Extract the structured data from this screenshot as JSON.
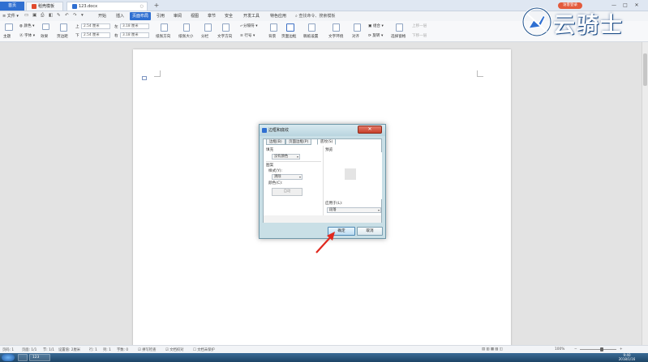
{
  "tabs": {
    "home": "首页",
    "template": "稻壳模板",
    "document": "123.docx",
    "add": "+"
  },
  "header_right": {
    "login": "访客登录",
    "window_controls": [
      "—",
      "□",
      "✕"
    ]
  },
  "menubar": {
    "file": "文件",
    "items": [
      "开始",
      "插入",
      "页面布局",
      "引用",
      "审阅",
      "视图",
      "章节",
      "安全",
      "开发工具",
      "特色应用"
    ],
    "active": "页面布局",
    "command_search": "查找命令、搜索模板"
  },
  "ribbon": {
    "theme": "主题",
    "colors": "颜色",
    "fonts": "字体",
    "effects": "效果",
    "margins": "页边距",
    "top_label": "上",
    "top_value": "2.54 厘米",
    "bottom_label": "下",
    "bottom_value": "2.54 厘米",
    "left_label": "左",
    "left_value": "3.18 厘米",
    "right_label": "右",
    "right_value": "3.18 厘米",
    "orientation": "纸张方向",
    "size": "纸张大小",
    "columns": "分栏",
    "text_direction": "文字方向",
    "line_numbers": "行号",
    "breaks": "分隔符",
    "background": "背景",
    "page_border": "页面边框",
    "draft_watermark": "稿纸设置",
    "text_wrap": "文字环绕",
    "align": "对齐",
    "rotate": "旋转",
    "group": "组合",
    "selection_pane": "选择窗格",
    "bring_forward": "上移一层",
    "send_backward": "下移一层"
  },
  "dialog": {
    "title": "边框和底纹",
    "close": "✕",
    "tabs": [
      "边框(B)",
      "页面边框(P)",
      "底纹(S)"
    ],
    "active_tab": "底纹(S)",
    "fill_label": "填充",
    "fill_value": "没有颜色",
    "pattern_label": "图案",
    "style_label": "样式(Y):",
    "style_value": "清除",
    "color_label": "颜色(C):",
    "color_value": "自动",
    "preview_label": "预览",
    "apply_to_label": "应用于(L):",
    "apply_to_value": "段落",
    "ok": "确定",
    "cancel": "取消"
  },
  "statusbar": {
    "page": "页码: 1",
    "pages": "页面: 1/1",
    "section": "节: 1/1",
    "setting": "设置值: 2厘米",
    "row": "行: 1",
    "col": "列: 1",
    "chars": "字数: 0",
    "spell": "拼写检查",
    "doc_check": "文档校对",
    "protect": "文档未保护",
    "zoom": "100%"
  },
  "taskbar": {
    "app": "123",
    "time": "9:40",
    "date": "2018/1/16"
  },
  "watermark": "云骑士",
  "colors": {
    "accent": "#2f6fd1",
    "dialog_frame": "#c9dfe6",
    "close_button": "#c8412b",
    "arrow": "#e0281e"
  }
}
